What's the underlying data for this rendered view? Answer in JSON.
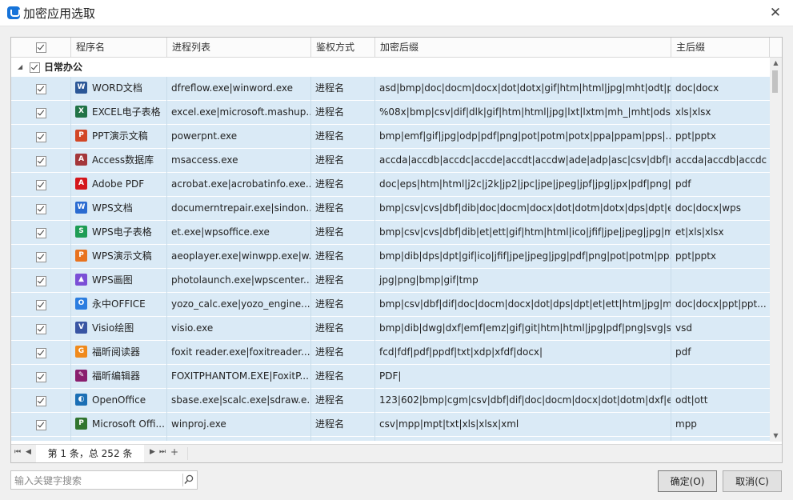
{
  "window": {
    "title": "加密应用选取",
    "close": "✕"
  },
  "columns": [
    "程序名",
    "进程列表",
    "鉴权方式",
    "加密后缀",
    "主后缀"
  ],
  "group": {
    "name": "日常办公"
  },
  "rows": [
    {
      "icon": "word-icon",
      "color": "#2b5797",
      "glyph": "W",
      "name": "WORD文档",
      "process": "dfreflow.exe|winword.exe",
      "auth": "进程名",
      "ext": "asd|bmp|doc|docm|docx|dot|dotx|gif|htm|html|jpg|mht|odt|p...",
      "main": "doc|docx"
    },
    {
      "icon": "excel-icon",
      "color": "#217346",
      "glyph": "X",
      "name": "EXCEL电子表格",
      "process": "excel.exe|microsoft.mashup....",
      "auth": "进程名",
      "ext": "%08x|bmp|csv|dif|dlk|gif|htm|html|jpg|lxt|lxtm|mh_|mht|ods|p...",
      "main": "xls|xlsx"
    },
    {
      "icon": "powerpoint-icon",
      "color": "#d24726",
      "glyph": "P",
      "name": "PPT演示文稿",
      "process": "powerpnt.exe",
      "auth": "进程名",
      "ext": "bmp|emf|gif|jpg|odp|pdf|png|pot|potm|potx|ppa|ppam|pps|...",
      "main": "ppt|pptx"
    },
    {
      "icon": "access-icon",
      "color": "#a4373a",
      "glyph": "A",
      "name": "Access数据库",
      "process": "msaccess.exe",
      "auth": "进程名",
      "ext": "accda|accdb|accdc|accde|accdt|accdw|ade|adp|asc|csv|dbf|m...",
      "main": "accda|accdb|accdc"
    },
    {
      "icon": "adobe-pdf-icon",
      "color": "#d4161b",
      "glyph": "A",
      "name": "Adobe PDF",
      "process": "acrobat.exe|acrobatinfo.exe...",
      "auth": "进程名",
      "ext": "doc|eps|htm|html|j2c|j2k|jp2|jpc|jpe|jpeg|jpf|jpg|jpx|pdf|png|p...",
      "main": "pdf"
    },
    {
      "icon": "wps-writer-icon",
      "color": "#2a6bd1",
      "glyph": "W",
      "name": "WPS文档",
      "process": "documerntrepair.exe|sindon...",
      "auth": "进程名",
      "ext": "bmp|csv|cvs|dbf|dib|doc|docm|docx|dot|dotm|dotx|dps|dpt|e...",
      "main": "doc|docx|wps"
    },
    {
      "icon": "wps-sheet-icon",
      "color": "#1f9d55",
      "glyph": "S",
      "name": "WPS电子表格",
      "process": "et.exe|wpsoffice.exe",
      "auth": "进程名",
      "ext": "bmp|csv|cvs|dbf|dib|et|ett|gif|htm|html|ico|jfif|jpe|jpeg|jpg|mh...",
      "main": "et|xls|xlsx"
    },
    {
      "icon": "wps-presentation-icon",
      "color": "#e8731f",
      "glyph": "P",
      "name": "WPS演示文稿",
      "process": "aeoplayer.exe|winwpp.exe|w...",
      "auth": "进程名",
      "ext": "bmp|dib|dps|dpt|gif|ico|jfif|jpe|jpeg|jpg|pdf|png|pot|potm|pp...",
      "main": "ppt|pptx"
    },
    {
      "icon": "wps-picture-icon",
      "color": "#7b4fd6",
      "glyph": "▲",
      "name": "WPS画图",
      "process": "photolaunch.exe|wpscenter....",
      "auth": "进程名",
      "ext": "jpg|png|bmp|gif|tmp",
      "main": ""
    },
    {
      "icon": "yozo-office-icon",
      "color": "#2b7de0",
      "glyph": "O",
      "name": "永中OFFICE",
      "process": "yozo_calc.exe|yozo_engine....",
      "auth": "进程名",
      "ext": "bmp|csv|dbf|dif|doc|docm|docx|dot|dps|dpt|et|ett|htm|jpg|mh...",
      "main": "doc|docx|ppt|ppt..."
    },
    {
      "icon": "visio-icon",
      "color": "#3955a3",
      "glyph": "V",
      "name": "Visio绘图",
      "process": "visio.exe",
      "auth": "进程名",
      "ext": "bmp|dib|dwg|dxf|emf|emz|gif|git|htm|html|jpg|pdf|png|svg|sv...",
      "main": "vsd"
    },
    {
      "icon": "foxit-reader-icon",
      "color": "#f08a1c",
      "glyph": "G",
      "name": "福昕阅读器",
      "process": "foxit reader.exe|foxitreader....",
      "auth": "进程名",
      "ext": "fcd|fdf|pdf|ppdf|txt|xdp|xfdf|docx|",
      "main": "pdf"
    },
    {
      "icon": "foxit-editor-icon",
      "color": "#8a1f6e",
      "glyph": "✎",
      "name": "福昕编辑器",
      "process": "FOXITPHANTOM.EXE|FoxitP...",
      "auth": "进程名",
      "ext": "PDF|",
      "main": ""
    },
    {
      "icon": "openoffice-icon",
      "color": "#1b6fb5",
      "glyph": "◐",
      "name": "OpenOffice",
      "process": "sbase.exe|scalc.exe|sdraw.e...",
      "auth": "进程名",
      "ext": "123|602|bmp|cgm|csv|dbf|dif|doc|docm|docx|dot|dotm|dxf|e...",
      "main": "odt|ott"
    },
    {
      "icon": "ms-project-icon",
      "color": "#31752f",
      "glyph": "P",
      "name": "Microsoft Offi...",
      "process": "winproj.exe",
      "auth": "进程名",
      "ext": "csv|mpp|mpt|txt|xls|xlsx|xml",
      "main": "mpp"
    },
    {
      "icon": "generic-app-icon",
      "color": "#e0a030",
      "glyph": "",
      "name": "",
      "process": "",
      "auth": "",
      "ext": "",
      "main": ""
    }
  ],
  "pager": {
    "text": "第 1 条，总 252 条"
  },
  "search": {
    "placeholder": "输入关键字搜索",
    "value": ""
  },
  "buttons": {
    "ok": "确定(O)",
    "cancel": "取消(C)"
  }
}
